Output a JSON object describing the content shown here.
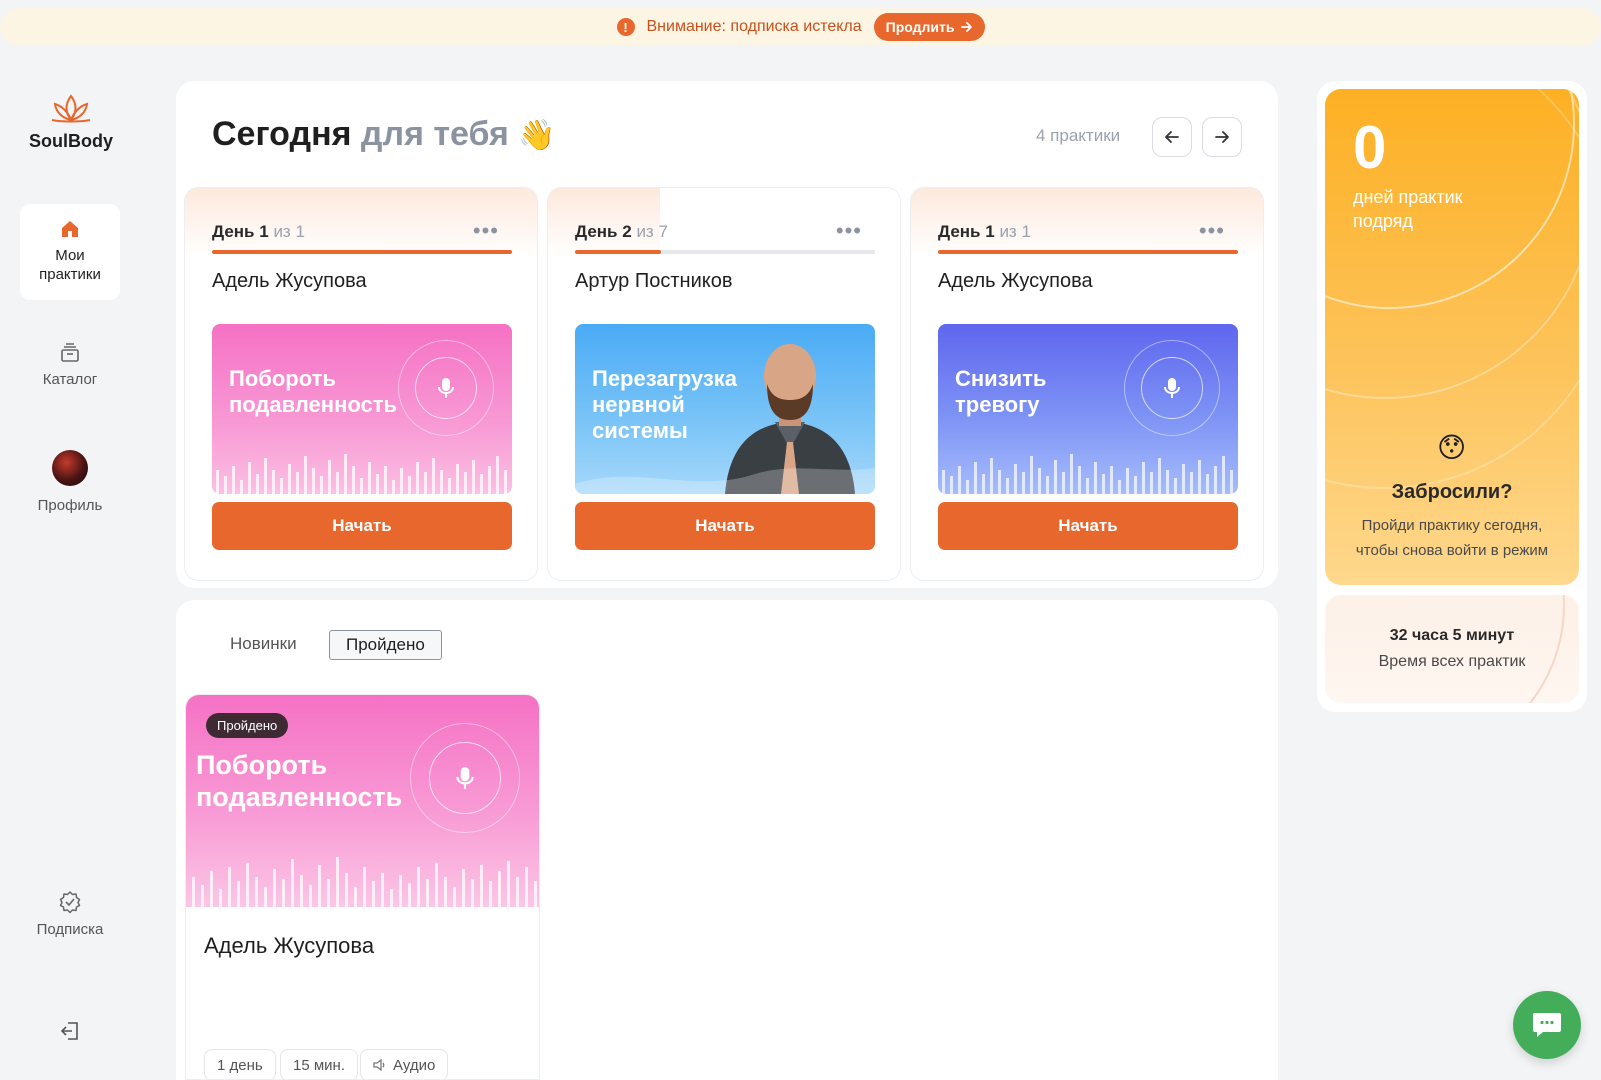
{
  "banner": {
    "text": "Внимание: подписка истекла",
    "button": "Продлить"
  },
  "app": {
    "logo": "SoulBody"
  },
  "sidebar": {
    "items": [
      {
        "label": "Мои практики",
        "icon": "home-icon"
      },
      {
        "label": "Каталог",
        "icon": "catalog-icon"
      },
      {
        "label": "Профиль",
        "icon": "avatar"
      },
      {
        "label": "Подписка",
        "icon": "subscription-check-icon"
      },
      {
        "label": "",
        "icon": "logout-icon"
      }
    ]
  },
  "today": {
    "title": "Сегодня",
    "title_muted": "для тебя",
    "count": "4 практики",
    "cards": [
      {
        "day_prefix": "День",
        "day": "1",
        "of": "из 1",
        "progress": 1.0,
        "author": "Адель Жусупова",
        "thumb_title": "Побороть подавленность",
        "button": "Начать"
      },
      {
        "day_prefix": "День",
        "day": "2",
        "of": "из 7",
        "progress": 0.286,
        "author": "Артур Постников",
        "thumb_title": "Перезагрузка нервной системы",
        "button": "Начать"
      },
      {
        "day_prefix": "День",
        "day": "1",
        "of": "из 1",
        "progress": 1.0,
        "author": "Адель Жусупова",
        "thumb_title": "Снизить тревогу",
        "button": "Начать"
      }
    ]
  },
  "tabs": {
    "new": "Новинки",
    "done": "Пройдено"
  },
  "done_card": {
    "badge": "Пройдено",
    "title": "Побороть подавленность",
    "author": "Адель Жусупова",
    "chips": [
      "1 день",
      "15 мин.",
      "Аудио"
    ]
  },
  "streak": {
    "value": "0",
    "label": "дней практик подряд",
    "title": "Забросили?",
    "text": "Пройди практику сегодня, чтобы снова войти в режим"
  },
  "total_time": {
    "value": "32 часа 5 минут",
    "label": "Время всех практик"
  },
  "colors": {
    "accent": "#e8672d",
    "streak": "#fdb023",
    "chat": "#43ad5a"
  }
}
